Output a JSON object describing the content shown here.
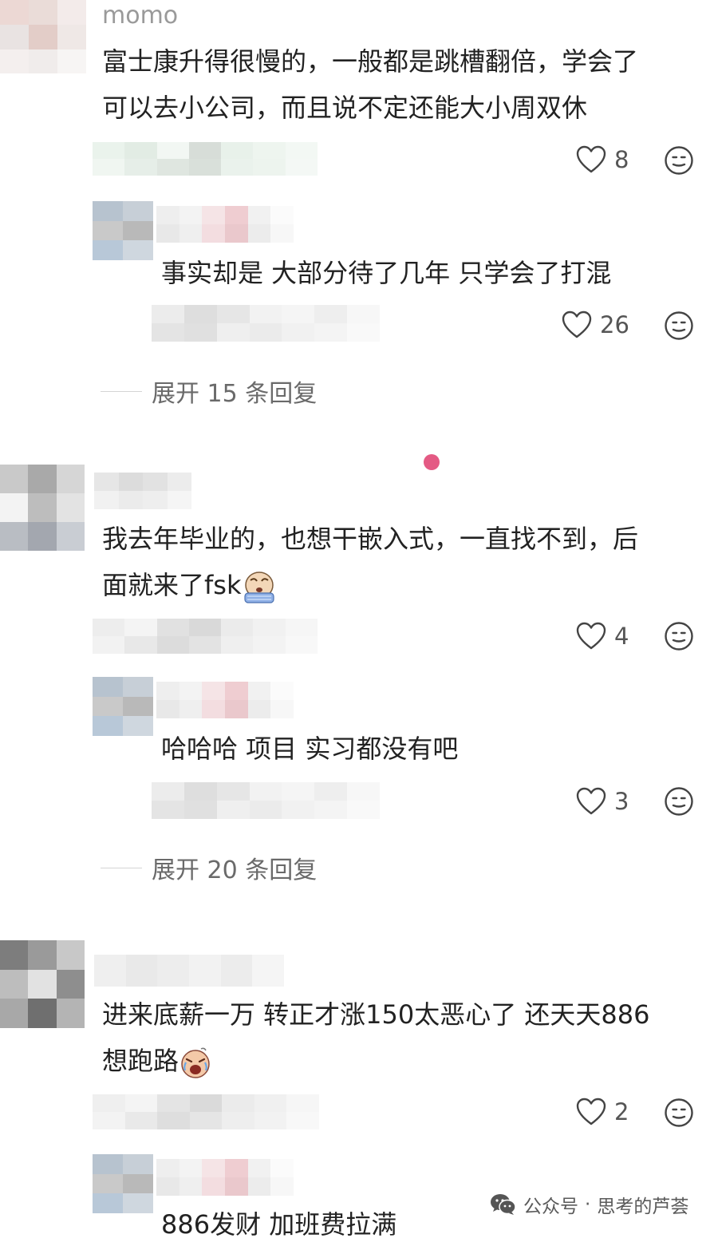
{
  "comments": [
    {
      "username": "momo",
      "lines": [
        "富士康升得很慢的，一般都是跳槽翻倍，学会了",
        "可以去小公司，而且说不定还能大小周双休"
      ],
      "likes": "8",
      "reply": {
        "text": "事实却是 大部分待了几年 只学会了打混",
        "likes": "26"
      },
      "expand_label": "展开 15 条回复"
    },
    {
      "lines": [
        "我去年毕业的，也想干嵌入式，一直找不到，后",
        "面就来了fsk"
      ],
      "emoji": "crying-emoji",
      "likes": "4",
      "reply": {
        "text": "哈哈哈 项目 实习都没有吧",
        "likes": "3"
      },
      "expand_label": "展开 20 条回复"
    },
    {
      "lines": [
        "进来底薪一万 转正才涨150太恶心了 还天天886",
        "想跑路"
      ],
      "emoji": "sob-emoji",
      "likes": "2",
      "reply": {
        "text": "886发财 加班费拉满"
      }
    }
  ],
  "watermark": {
    "icon": "wechat-icon",
    "label": "公众号",
    "dot": "·",
    "name": "思考的芦荟"
  },
  "colors": {
    "accent_dot": "#e45a84",
    "muted": "#9a9a9a",
    "text": "#222222"
  }
}
